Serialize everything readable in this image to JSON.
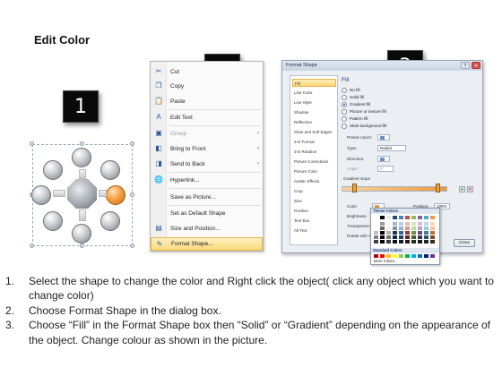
{
  "title": "Edit Color",
  "steps": {
    "one": "1",
    "two": "2",
    "three": "3"
  },
  "context_menu": {
    "items": [
      {
        "label": "Cut",
        "icon": "scissors-icon",
        "glyph": "✂"
      },
      {
        "label": "Copy",
        "icon": "copy-icon",
        "glyph": "❐"
      },
      {
        "label": "Paste",
        "icon": "paste-icon",
        "glyph": "📋"
      },
      {
        "label": "Edit Text",
        "icon": "edit-text-icon",
        "glyph": "A"
      },
      {
        "label": "Group",
        "icon": "group-icon",
        "glyph": "▣"
      },
      {
        "label": "Bring to Front",
        "icon": "bring-front-icon",
        "glyph": "◧"
      },
      {
        "label": "Send to Back",
        "icon": "send-back-icon",
        "glyph": "◨"
      },
      {
        "label": "Hyperlink...",
        "icon": "hyperlink-icon",
        "glyph": "🌐"
      },
      {
        "label": "Save as Picture...",
        "icon": "",
        "glyph": ""
      },
      {
        "label": "Set as Default Shape",
        "icon": "",
        "glyph": ""
      },
      {
        "label": "Size and Position...",
        "icon": "size-position-icon",
        "glyph": "▤"
      },
      {
        "label": "Format Shape...",
        "icon": "format-shape-icon",
        "glyph": "✎"
      }
    ]
  },
  "dialog": {
    "title": "Format Shape",
    "nav": [
      "Fill",
      "Line Color",
      "Line Style",
      "Shadow",
      "Reflection",
      "Glow and Soft Edges",
      "3-D Format",
      "3-D Rotation",
      "Picture Corrections",
      "Picture Color",
      "Artistic Effects",
      "Crop",
      "Size",
      "Position",
      "Text Box",
      "Alt Text"
    ],
    "fill_heading": "Fill",
    "options": [
      "No fill",
      "Solid fill",
      "Gradient fill",
      "Picture or texture fill",
      "Pattern fill",
      "Slide background fill"
    ],
    "preset_label": "Preset colors:",
    "type_label": "Type:",
    "type_value": "Radial",
    "direction_label": "Direction:",
    "angle_label": "Angle:",
    "angle_value": "0°",
    "stops_label": "Gradient stops",
    "color_label": "Color",
    "position_label": "Position:",
    "position_value": "100%",
    "brightness_label": "Brightness",
    "transparency_label": "Transparency",
    "rotate_label": "Rotate with shape",
    "theme_colors_label": "Theme Colors",
    "standard_colors_label": "Standard Colors",
    "more_colors_label": "More Colors...",
    "close_label": "Close"
  },
  "instructions": [
    {
      "num": "1.",
      "text": "Select the shape to change the color and Right click the object( click any object which you want to change color)"
    },
    {
      "num": "2.",
      "text": "Choose Format Shape in the dialog box."
    },
    {
      "num": "3.",
      "text": "Choose “Fill” in the Format Shape box then “Solid” or “Gradient” depending on the appearance of the object. Change colour as shown in the picture."
    }
  ]
}
